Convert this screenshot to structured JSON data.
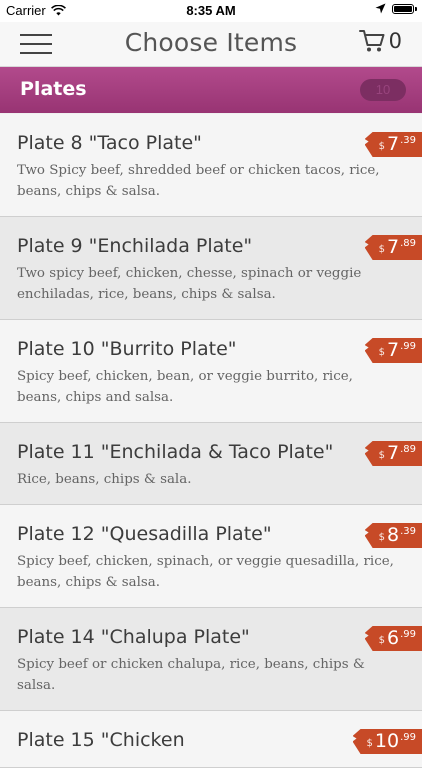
{
  "status_bar": {
    "carrier": "Carrier",
    "time": "8:35 AM"
  },
  "nav": {
    "title": "Choose Items",
    "cart_count": "0"
  },
  "section": {
    "title": "Plates",
    "badge": "10"
  },
  "colors": {
    "section_header": "#a8407f",
    "price_tag": "#c74a27"
  },
  "items": [
    {
      "name": "Plate 8 \"Taco Plate\"",
      "description": "Two Spicy beef, shredded beef or chicken tacos, rice, beans, chips & salsa.",
      "currency": "$",
      "price_whole": "7",
      "price_cents": ".39"
    },
    {
      "name": "Plate 9 \"Enchilada Plate\"",
      "description": "Two spicy beef, chicken, chesse, spinach or veggie enchiladas, rice, beans, chips & salsa.",
      "currency": "$",
      "price_whole": "7",
      "price_cents": ".89"
    },
    {
      "name": "Plate 10 \"Burrito Plate\"",
      "description": "Spicy beef, chicken, bean, or veggie burrito, rice, beans, chips and salsa.",
      "currency": "$",
      "price_whole": "7",
      "price_cents": ".99"
    },
    {
      "name": "Plate 11 \"Enchilada & Taco Plate\"",
      "description": "Rice, beans, chips & sala.",
      "currency": "$",
      "price_whole": "7",
      "price_cents": ".89"
    },
    {
      "name": "Plate 12 \"Quesadilla Plate\"",
      "description": "Spicy beef, chicken, spinach, or veggie quesadilla, rice, beans, chips & salsa.",
      "currency": "$",
      "price_whole": "8",
      "price_cents": ".39"
    },
    {
      "name": "Plate 14 \"Chalupa Plate\"",
      "description": "Spicy beef or chicken chalupa, rice, beans, chips & salsa.",
      "currency": "$",
      "price_whole": "6",
      "price_cents": ".99"
    },
    {
      "name": "Plate 15 \"Chicken",
      "description": "",
      "currency": "$",
      "price_whole": "10",
      "price_cents": ".99"
    }
  ]
}
